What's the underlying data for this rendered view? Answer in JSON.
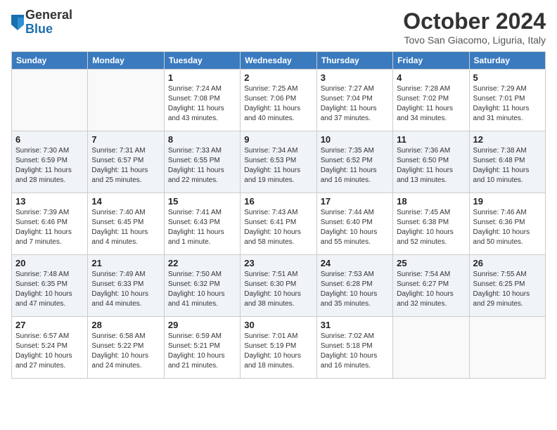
{
  "header": {
    "logo_general": "General",
    "logo_blue": "Blue",
    "month_title": "October 2024",
    "location": "Tovo San Giacomo, Liguria, Italy"
  },
  "days_of_week": [
    "Sunday",
    "Monday",
    "Tuesday",
    "Wednesday",
    "Thursday",
    "Friday",
    "Saturday"
  ],
  "weeks": [
    [
      {
        "day": "",
        "info": ""
      },
      {
        "day": "",
        "info": ""
      },
      {
        "day": "1",
        "info": "Sunrise: 7:24 AM\nSunset: 7:08 PM\nDaylight: 11 hours and 43 minutes."
      },
      {
        "day": "2",
        "info": "Sunrise: 7:25 AM\nSunset: 7:06 PM\nDaylight: 11 hours and 40 minutes."
      },
      {
        "day": "3",
        "info": "Sunrise: 7:27 AM\nSunset: 7:04 PM\nDaylight: 11 hours and 37 minutes."
      },
      {
        "day": "4",
        "info": "Sunrise: 7:28 AM\nSunset: 7:02 PM\nDaylight: 11 hours and 34 minutes."
      },
      {
        "day": "5",
        "info": "Sunrise: 7:29 AM\nSunset: 7:01 PM\nDaylight: 11 hours and 31 minutes."
      }
    ],
    [
      {
        "day": "6",
        "info": "Sunrise: 7:30 AM\nSunset: 6:59 PM\nDaylight: 11 hours and 28 minutes."
      },
      {
        "day": "7",
        "info": "Sunrise: 7:31 AM\nSunset: 6:57 PM\nDaylight: 11 hours and 25 minutes."
      },
      {
        "day": "8",
        "info": "Sunrise: 7:33 AM\nSunset: 6:55 PM\nDaylight: 11 hours and 22 minutes."
      },
      {
        "day": "9",
        "info": "Sunrise: 7:34 AM\nSunset: 6:53 PM\nDaylight: 11 hours and 19 minutes."
      },
      {
        "day": "10",
        "info": "Sunrise: 7:35 AM\nSunset: 6:52 PM\nDaylight: 11 hours and 16 minutes."
      },
      {
        "day": "11",
        "info": "Sunrise: 7:36 AM\nSunset: 6:50 PM\nDaylight: 11 hours and 13 minutes."
      },
      {
        "day": "12",
        "info": "Sunrise: 7:38 AM\nSunset: 6:48 PM\nDaylight: 11 hours and 10 minutes."
      }
    ],
    [
      {
        "day": "13",
        "info": "Sunrise: 7:39 AM\nSunset: 6:46 PM\nDaylight: 11 hours and 7 minutes."
      },
      {
        "day": "14",
        "info": "Sunrise: 7:40 AM\nSunset: 6:45 PM\nDaylight: 11 hours and 4 minutes."
      },
      {
        "day": "15",
        "info": "Sunrise: 7:41 AM\nSunset: 6:43 PM\nDaylight: 11 hours and 1 minute."
      },
      {
        "day": "16",
        "info": "Sunrise: 7:43 AM\nSunset: 6:41 PM\nDaylight: 10 hours and 58 minutes."
      },
      {
        "day": "17",
        "info": "Sunrise: 7:44 AM\nSunset: 6:40 PM\nDaylight: 10 hours and 55 minutes."
      },
      {
        "day": "18",
        "info": "Sunrise: 7:45 AM\nSunset: 6:38 PM\nDaylight: 10 hours and 52 minutes."
      },
      {
        "day": "19",
        "info": "Sunrise: 7:46 AM\nSunset: 6:36 PM\nDaylight: 10 hours and 50 minutes."
      }
    ],
    [
      {
        "day": "20",
        "info": "Sunrise: 7:48 AM\nSunset: 6:35 PM\nDaylight: 10 hours and 47 minutes."
      },
      {
        "day": "21",
        "info": "Sunrise: 7:49 AM\nSunset: 6:33 PM\nDaylight: 10 hours and 44 minutes."
      },
      {
        "day": "22",
        "info": "Sunrise: 7:50 AM\nSunset: 6:32 PM\nDaylight: 10 hours and 41 minutes."
      },
      {
        "day": "23",
        "info": "Sunrise: 7:51 AM\nSunset: 6:30 PM\nDaylight: 10 hours and 38 minutes."
      },
      {
        "day": "24",
        "info": "Sunrise: 7:53 AM\nSunset: 6:28 PM\nDaylight: 10 hours and 35 minutes."
      },
      {
        "day": "25",
        "info": "Sunrise: 7:54 AM\nSunset: 6:27 PM\nDaylight: 10 hours and 32 minutes."
      },
      {
        "day": "26",
        "info": "Sunrise: 7:55 AM\nSunset: 6:25 PM\nDaylight: 10 hours and 29 minutes."
      }
    ],
    [
      {
        "day": "27",
        "info": "Sunrise: 6:57 AM\nSunset: 5:24 PM\nDaylight: 10 hours and 27 minutes."
      },
      {
        "day": "28",
        "info": "Sunrise: 6:58 AM\nSunset: 5:22 PM\nDaylight: 10 hours and 24 minutes."
      },
      {
        "day": "29",
        "info": "Sunrise: 6:59 AM\nSunset: 5:21 PM\nDaylight: 10 hours and 21 minutes."
      },
      {
        "day": "30",
        "info": "Sunrise: 7:01 AM\nSunset: 5:19 PM\nDaylight: 10 hours and 18 minutes."
      },
      {
        "day": "31",
        "info": "Sunrise: 7:02 AM\nSunset: 5:18 PM\nDaylight: 10 hours and 16 minutes."
      },
      {
        "day": "",
        "info": ""
      },
      {
        "day": "",
        "info": ""
      }
    ]
  ]
}
